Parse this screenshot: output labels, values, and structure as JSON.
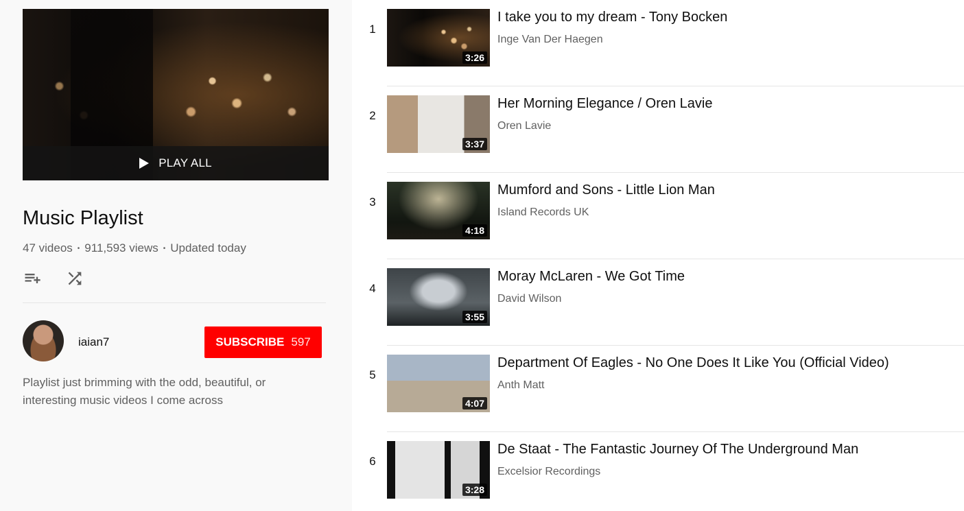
{
  "playlist": {
    "play_all_label": "PLAY ALL",
    "title": "Music Playlist",
    "video_count": "47 videos",
    "views": "911,593 views",
    "updated": "Updated today",
    "description": "Playlist just brimming with the odd, beautiful, or interesting music videos I come across",
    "actions": {
      "add_icon": "playlist-add-icon",
      "shuffle_icon": "shuffle-icon"
    }
  },
  "owner": {
    "name": "iaian7",
    "subscribe_label": "SUBSCRIBE",
    "subscriber_count": "597"
  },
  "colors": {
    "subscribe": "#ff0000",
    "sidebar_bg": "#f9f9f9",
    "secondary_text": "#606060"
  },
  "videos": [
    {
      "index": "1",
      "title": "I take you to my dream - Tony Bocken",
      "channel": "Inge Van Der Haegen",
      "duration": "3:26"
    },
    {
      "index": "2",
      "title": "Her Morning Elegance / Oren Lavie",
      "channel": "Oren Lavie",
      "duration": "3:37"
    },
    {
      "index": "3",
      "title": "Mumford and Sons - Little Lion Man",
      "channel": "Island Records UK",
      "duration": "4:18"
    },
    {
      "index": "4",
      "title": "Moray McLaren - We Got Time",
      "channel": "David Wilson",
      "duration": "3:55"
    },
    {
      "index": "5",
      "title": "Department Of Eagles - No One Does It Like You (Official Video)",
      "channel": "Anth Matt",
      "duration": "4:07"
    },
    {
      "index": "6",
      "title": "De Staat - The Fantastic Journey Of The Underground Man",
      "channel": "Excelsior Recordings",
      "duration": "3:28"
    }
  ]
}
